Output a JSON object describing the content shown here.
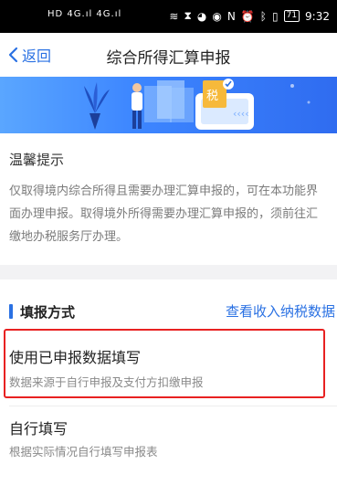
{
  "status_bar": {
    "signal": "HD 4G.ıl 4G.ıl",
    "icons": [
      "wifi-icon",
      "hourglass-icon",
      "wechat-icon",
      "eye-icon",
      "nfc-icon",
      "alarm-icon",
      "bluetooth-icon",
      "vibrate-icon"
    ],
    "battery": "71",
    "time": "9:32"
  },
  "nav": {
    "back_label": "返回",
    "title": "综合所得汇算申报"
  },
  "banner": {
    "doc_badge": "税",
    "colors": {
      "accent": "#2a71e3"
    }
  },
  "notice": {
    "title": "温馨提示",
    "body": "仅取得境内综合所得且需要办理汇算申报的，可在本功能界面办理申报。取得境外所得需要办理汇算申报的，须前往汇缴地办税服务厅办理。"
  },
  "method": {
    "title": "填报方式",
    "link": "查看收入纳税数据",
    "options": [
      {
        "label": "使用已申报数据填写",
        "desc": "数据来源于自行申报及支付方扣缴申报"
      },
      {
        "label": "自行填写",
        "desc": "根据实际情况自行填写申报表"
      }
    ]
  }
}
